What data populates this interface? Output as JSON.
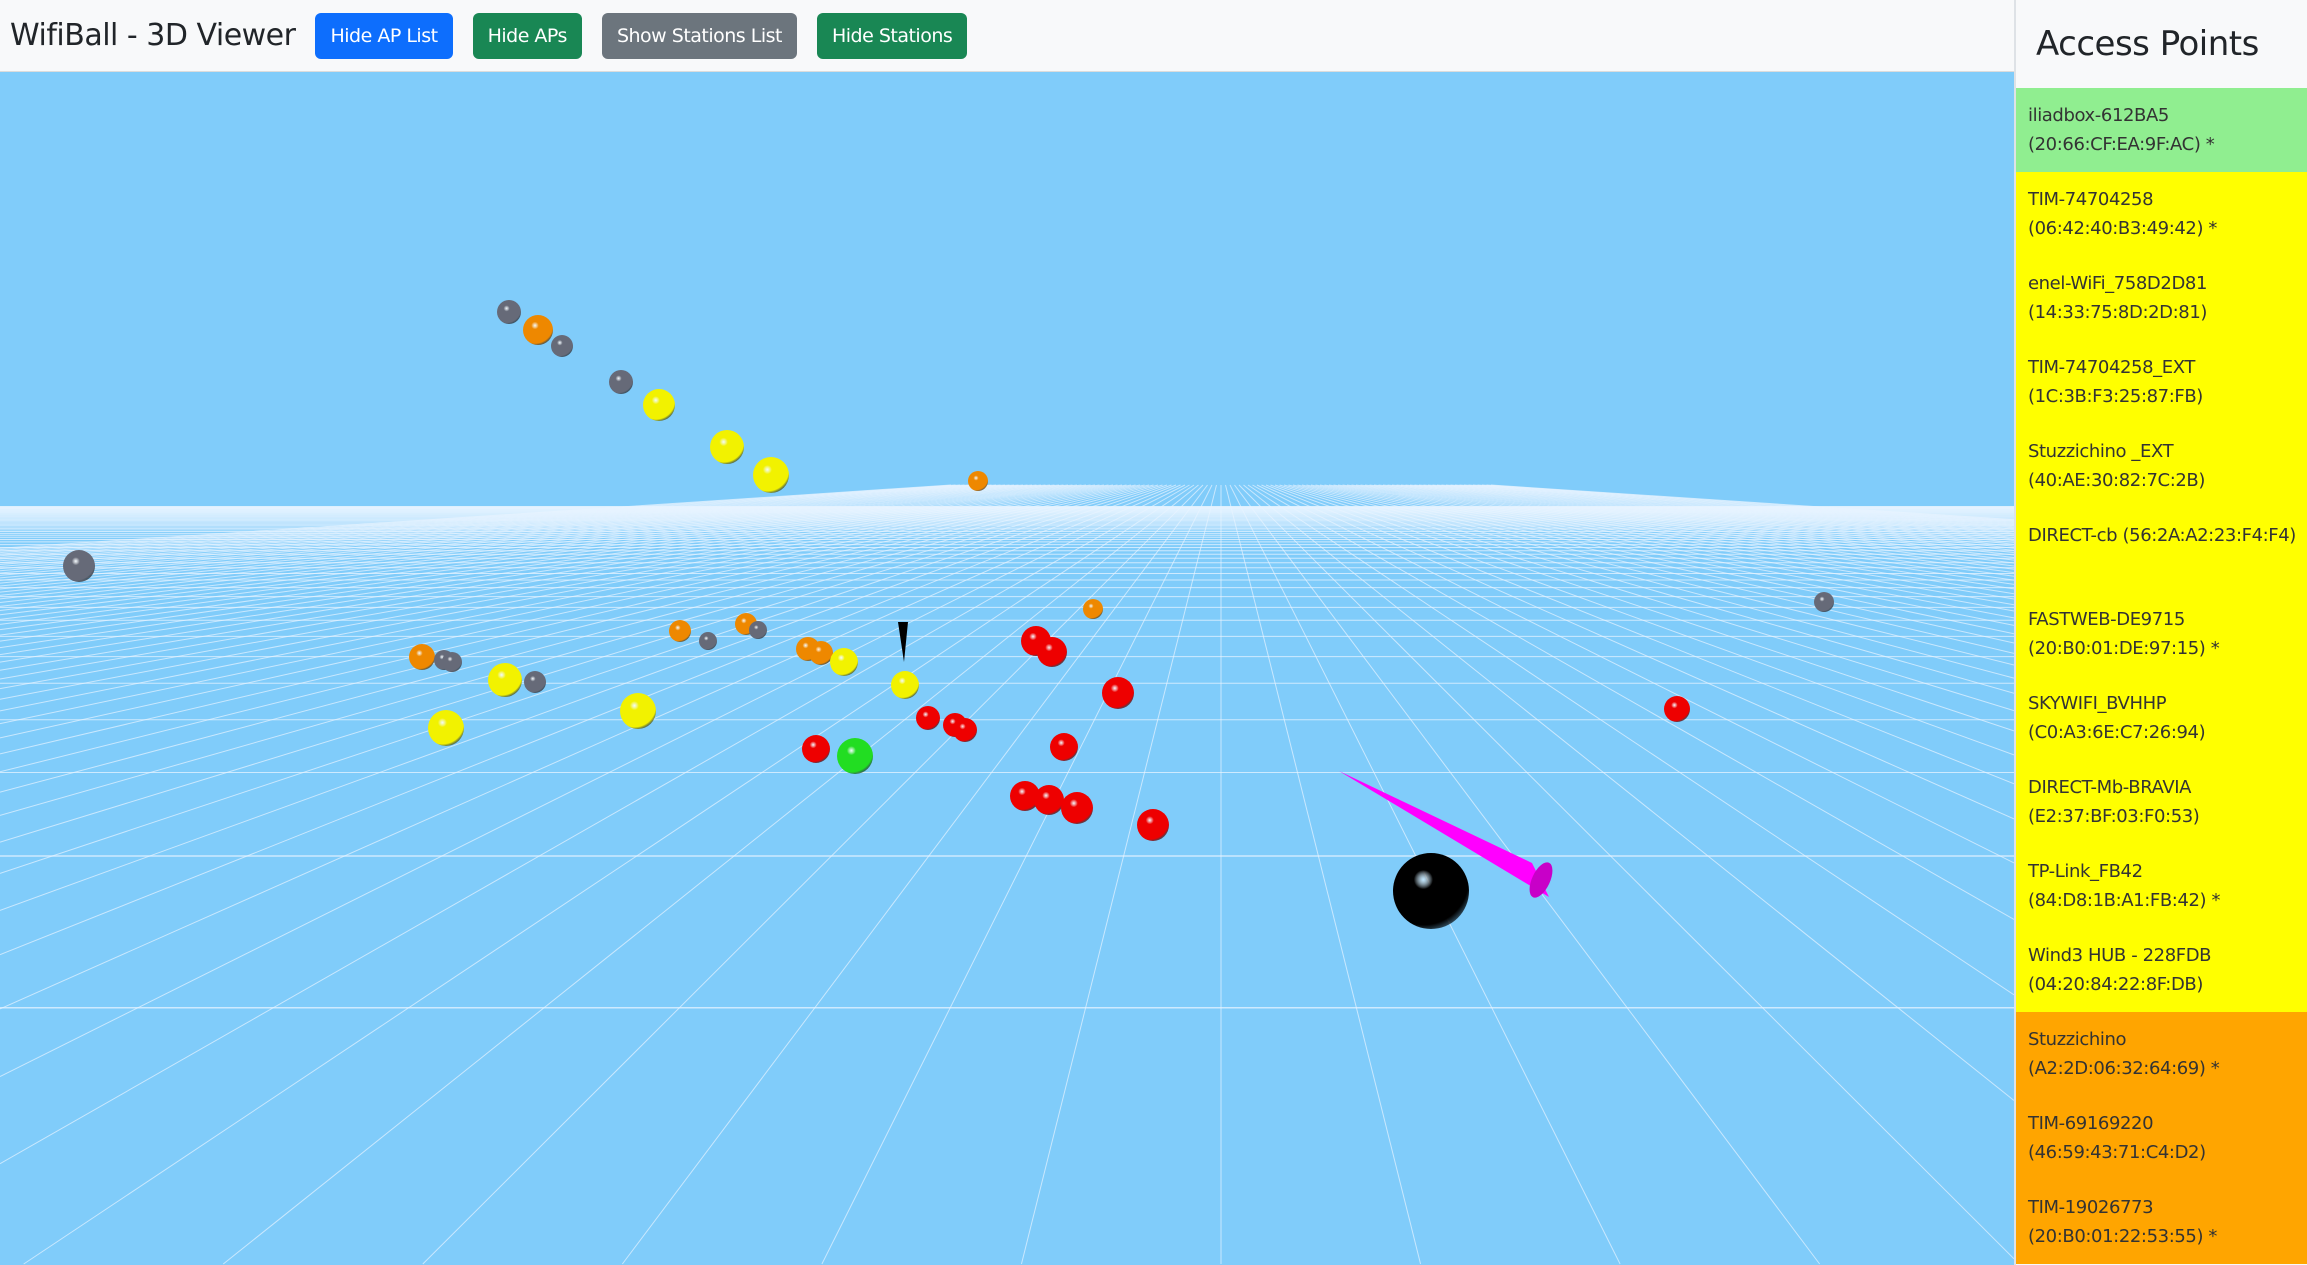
{
  "header": {
    "title": "WifiBall - 3D Viewer",
    "buttons": [
      {
        "label": "Hide AP List",
        "color": "#0d6efd"
      },
      {
        "label": "Hide APs",
        "color": "#198754"
      },
      {
        "label": "Show Stations List",
        "color": "#6c757d"
      },
      {
        "label": "Hide Stations",
        "color": "#198754"
      }
    ]
  },
  "sidebar": {
    "title": "Access Points",
    "items": [
      {
        "name": "iliadbox-612BA5",
        "mac": "(20:66:CF:EA:9F:AC) *",
        "color": "#90ee90"
      },
      {
        "name": "TIM-74704258",
        "mac": "(06:42:40:B3:49:42) *",
        "color": "#ffff00"
      },
      {
        "name": "enel-WiFi_758D2D81",
        "mac": "(14:33:75:8D:2D:81)",
        "color": "#ffff00"
      },
      {
        "name": "TIM-74704258_EXT",
        "mac": "(1C:3B:F3:25:87:FB)",
        "color": "#ffff00"
      },
      {
        "name": "Stuzzichino _EXT",
        "mac": "(40:AE:30:82:7C:2B)",
        "color": "#ffff00"
      },
      {
        "name": "DIRECT-cb",
        "mac": "(56:2A:A2:23:F4:F4)",
        "color": "#ffff00",
        "inline": true
      },
      {
        "name": "FASTWEB-DE9715",
        "mac": "(20:B0:01:DE:97:15) *",
        "color": "#ffff00"
      },
      {
        "name": "SKYWIFI_BVHHP",
        "mac": "(C0:A3:6E:C7:26:94)",
        "color": "#ffff00"
      },
      {
        "name": "DIRECT-Mb-BRAVIA",
        "mac": "(E2:37:BF:03:F0:53)",
        "color": "#ffff00"
      },
      {
        "name": "TP-Link_FB42",
        "mac": "(84:D8:1B:A1:FB:42) *",
        "color": "#ffff00"
      },
      {
        "name": "Wind3 HUB - 228FDB",
        "mac": "(04:20:84:22:8F:DB)",
        "color": "#ffff00"
      },
      {
        "name": "Stuzzichino",
        "mac": "(A2:2D:06:32:64:69) *",
        "color": "#ffa500"
      },
      {
        "name": "TIM-69169220",
        "mac": "(46:59:43:71:C4:D2)",
        "color": "#ffa500"
      },
      {
        "name": "TIM-19026773",
        "mac": "(20:B0:01:22:53:55) *",
        "color": "#ffa500"
      }
    ]
  },
  "scene": {
    "background": "#80ccfa",
    "palette": {
      "green": "#22dd22",
      "yellow": "#f2f200",
      "orange": "#ee8800",
      "red": "#ee0000",
      "gray": "#666a78",
      "black": "#000000",
      "pointer": "#ff00ff"
    }
  }
}
